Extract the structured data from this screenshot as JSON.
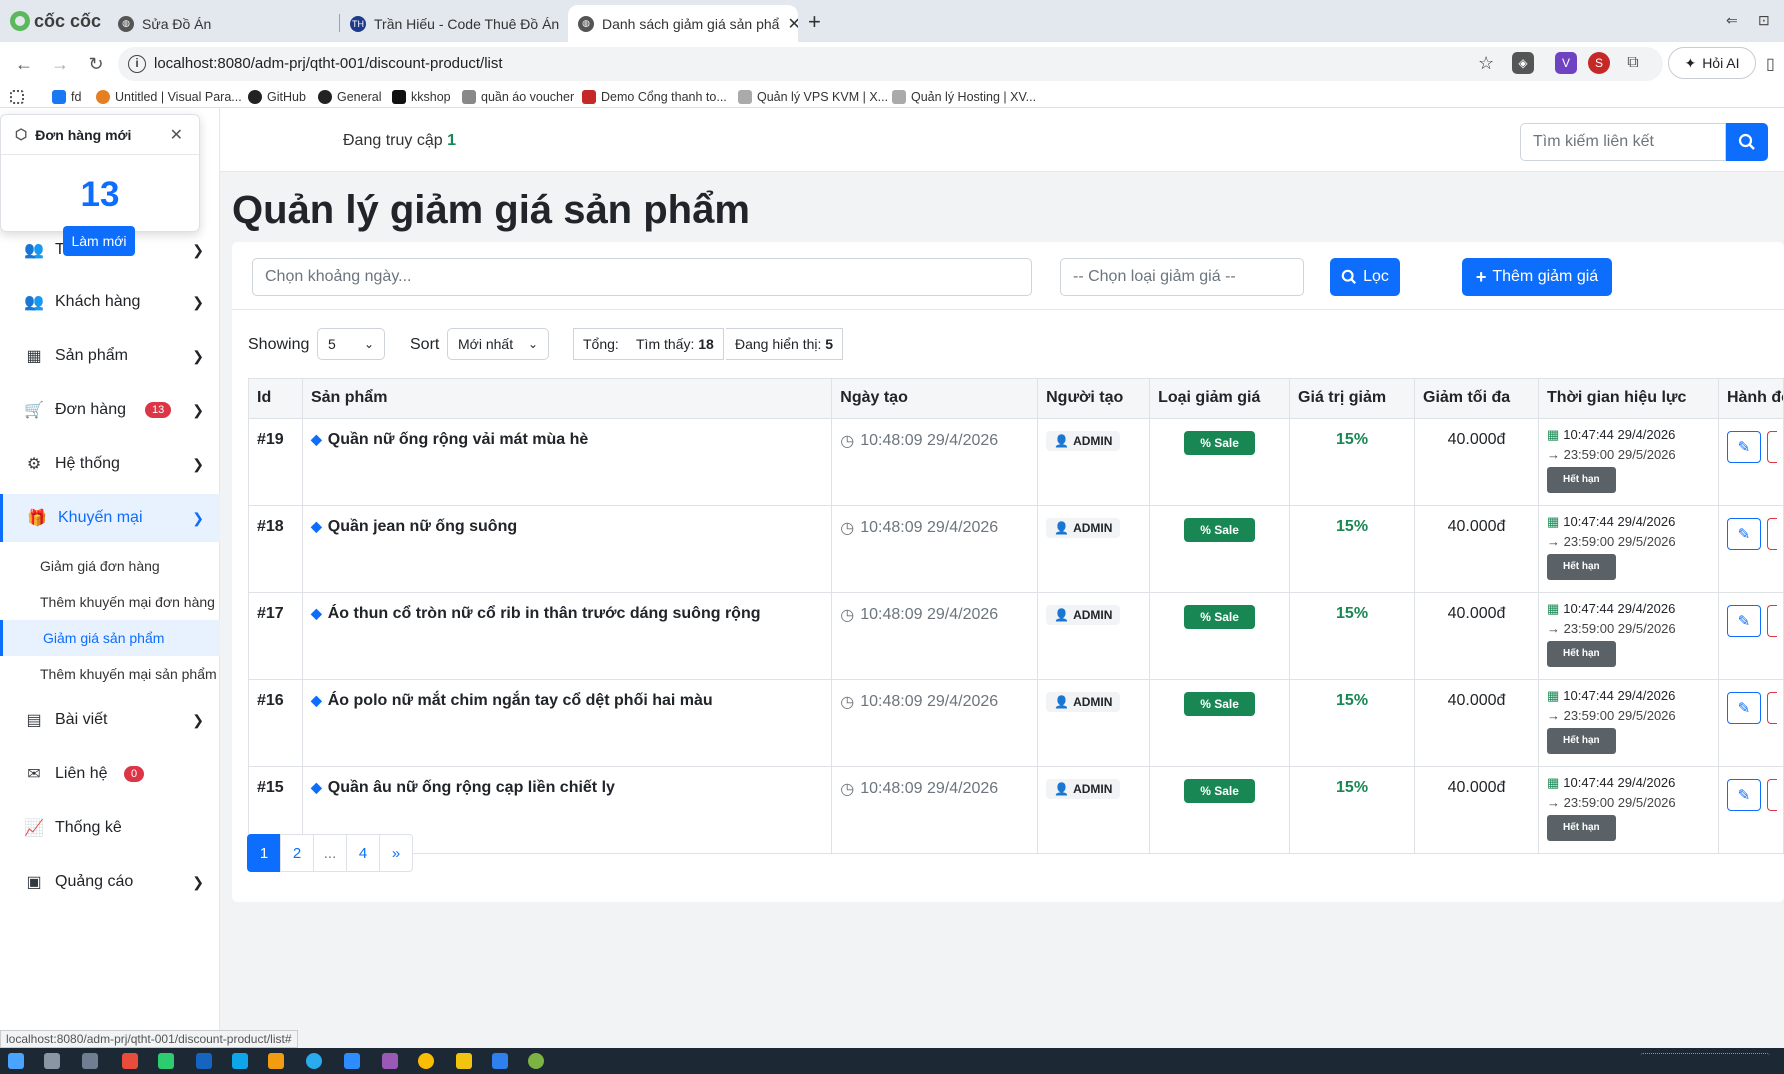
{
  "browser": {
    "logo_text": "cốc cốc",
    "tabs": [
      {
        "title": "Sửa Đồ Án"
      },
      {
        "title": "Trần Hiếu - Code Thuê Đồ Án - J"
      },
      {
        "title": "Danh sách giảm giá sản phẩ",
        "active": true
      }
    ],
    "new_tab": "+",
    "url": "localhost:8080/adm-prj/qtht-001/discount-product/list",
    "ai_label": "Hỏi AI",
    "bookmarks": [
      "fd",
      "Untitled | Visual Para...",
      "GitHub",
      "General",
      "kkshop",
      "quần áo voucher",
      "Demo Cổng thanh to...",
      "Quản lý VPS KVM | X...",
      "Quản lý Hosting | XV..."
    ]
  },
  "popup": {
    "title": "Đơn hàng mới",
    "count": "13",
    "refresh_label": "Làm mới"
  },
  "topbar": {
    "online_label": "Đang truy cập",
    "online_count": "1",
    "search_placeholder": "Tìm kiếm liên kết"
  },
  "sidebar": {
    "items": [
      {
        "label": "T",
        "icon": "users-icon"
      },
      {
        "label": "Khách hàng",
        "icon": "customers-icon"
      },
      {
        "label": "Sản phẩm",
        "icon": "products-icon"
      },
      {
        "label": "Đơn hàng",
        "icon": "cart-icon",
        "badge": "13"
      },
      {
        "label": "Hệ thống",
        "icon": "gears-icon"
      },
      {
        "label": "Khuyến mại",
        "icon": "gift-icon",
        "active": true
      },
      {
        "label": "Bài viết",
        "icon": "newspaper-icon"
      },
      {
        "label": "Liên hệ",
        "icon": "envelope-icon",
        "badge": "0"
      },
      {
        "label": "Thống kê",
        "icon": "chart-icon"
      },
      {
        "label": "Quảng cáo",
        "icon": "ad-icon"
      }
    ],
    "subitems": [
      {
        "label": "Giảm giá đơn hàng"
      },
      {
        "label": "Thêm khuyến mại đơn hàng"
      },
      {
        "label": "Giảm giá sản phẩm",
        "active": true
      },
      {
        "label": "Thêm khuyến mại sản phẩm"
      }
    ]
  },
  "page": {
    "title": "Quản lý giảm giá sản phẩm",
    "date_placeholder": "Chọn khoảng ngày...",
    "type_placeholder": "-- Chọn loại giảm giá --",
    "filter_label": "Lọc",
    "add_label": "Thêm giảm giá",
    "showing_label": "Showing",
    "showing_value": "5",
    "sort_label": "Sort",
    "sort_value": "Mới nhất",
    "total_label": "Tổng:",
    "found_label": "Tìm thấy:",
    "found_value": "18",
    "displaying_label": "Đang hiển thị:",
    "displaying_value": "5"
  },
  "table": {
    "headers": [
      "Id",
      "Sản phẩm",
      "Ngày tạo",
      "Người tạo",
      "Loại giảm giá",
      "Giá trị giảm",
      "Giảm tối đa",
      "Thời gian hiệu lực",
      "Hành động"
    ],
    "rows": [
      {
        "id": "#19",
        "product": "Quần nữ ống rộng vải mát mùa hè",
        "created": "10:48:09 29/4/2026",
        "creator": "ADMIN",
        "type": "% Sale",
        "value": "15%",
        "max": "40.000đ",
        "start": "10:47:44 29/4/2026",
        "end": "→ 23:59:00 29/5/2026",
        "status": "Hết hạn"
      },
      {
        "id": "#18",
        "product": "Quần jean nữ ống suông",
        "created": "10:48:09 29/4/2026",
        "creator": "ADMIN",
        "type": "% Sale",
        "value": "15%",
        "max": "40.000đ",
        "start": "10:47:44 29/4/2026",
        "end": "→ 23:59:00 29/5/2026",
        "status": "Hết hạn"
      },
      {
        "id": "#17",
        "product": "Áo thun cổ tròn nữ cổ rib in thân trước dáng suông rộng",
        "created": "10:48:09 29/4/2026",
        "creator": "ADMIN",
        "type": "% Sale",
        "value": "15%",
        "max": "40.000đ",
        "start": "10:47:44 29/4/2026",
        "end": "→ 23:59:00 29/5/2026",
        "status": "Hết hạn"
      },
      {
        "id": "#16",
        "product": "Áo polo nữ mắt chim ngắn tay cổ dệt phối hai màu",
        "created": "10:48:09 29/4/2026",
        "creator": "ADMIN",
        "type": "% Sale",
        "value": "15%",
        "max": "40.000đ",
        "start": "10:47:44 29/4/2026",
        "end": "→ 23:59:00 29/5/2026",
        "status": "Hết hạn"
      },
      {
        "id": "#15",
        "product": "Quần âu nữ ống rộng cạp liền chiết ly",
        "created": "10:48:09 29/4/2026",
        "creator": "ADMIN",
        "type": "% Sale",
        "value": "15%",
        "max": "40.000đ",
        "start": "10:47:44 29/4/2026",
        "end": "→ 23:59:00 29/5/2026",
        "status": "Hết hạn"
      }
    ]
  },
  "pagination": [
    "1",
    "2",
    "...",
    "4",
    "»"
  ],
  "status_url": "localhost:8080/adm-prj/qtht-001/discount-product/list#",
  "colors": {
    "primary": "#0d6efd",
    "success": "#198754",
    "danger": "#dc3545"
  }
}
